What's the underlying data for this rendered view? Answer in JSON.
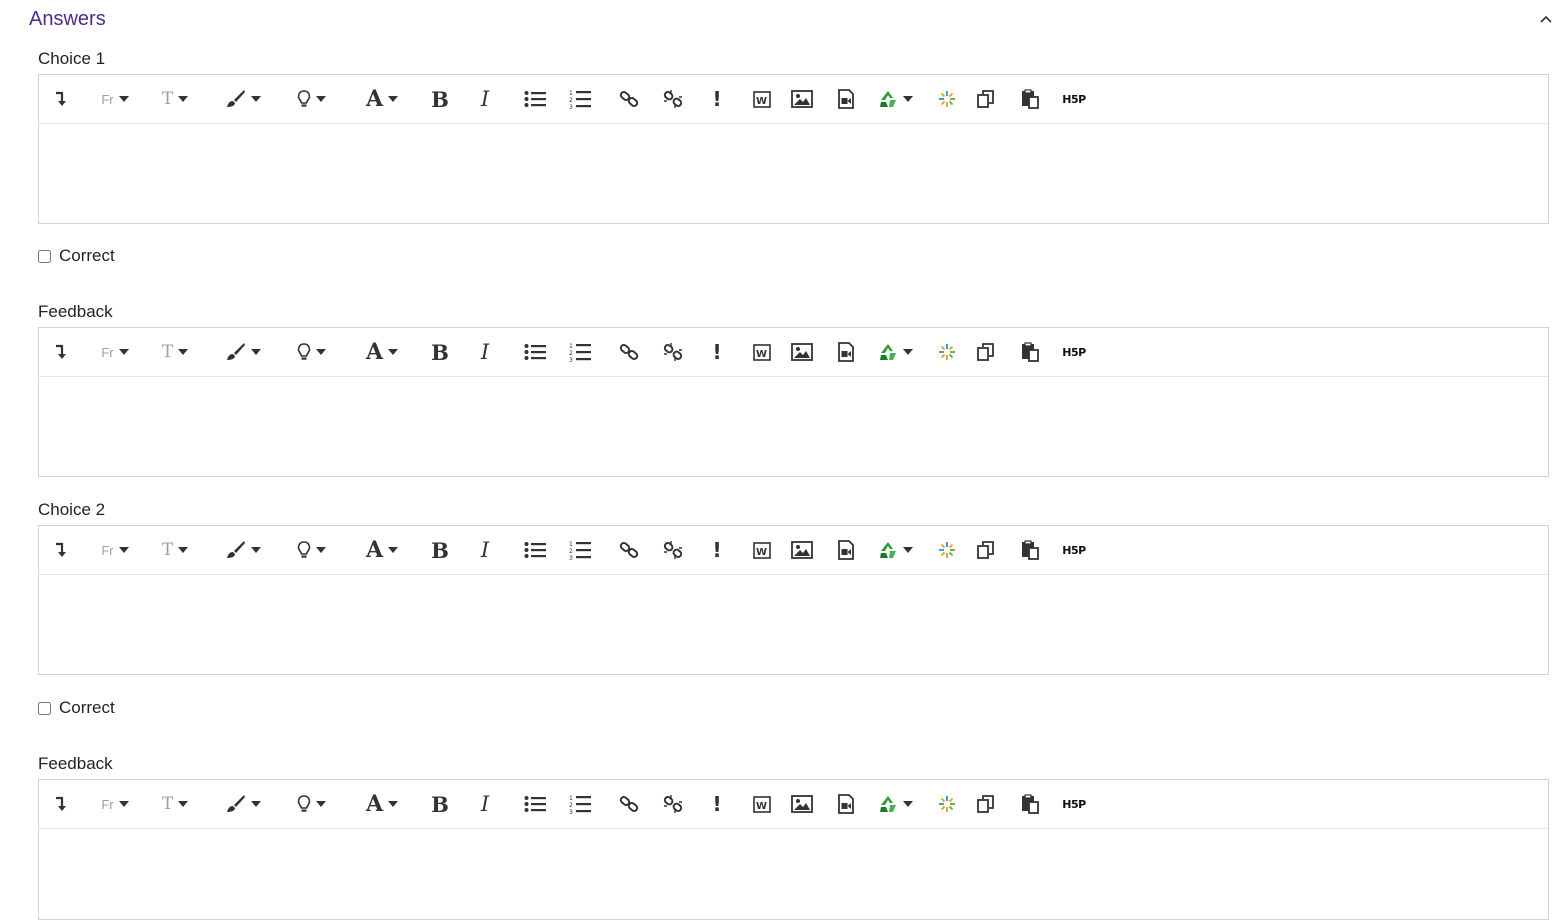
{
  "section": {
    "title": "Answers",
    "toggle_icon": "chevron-up-icon"
  },
  "toolbar_buttons": [
    "collapse-icon",
    "font-family-icon",
    "font-size-icon",
    "paintbrush-icon",
    "lightbulb-icon",
    "font-color-icon",
    "bold-icon",
    "italic-icon",
    "unordered-list-icon",
    "ordered-list-icon",
    "link-icon",
    "unlink-icon",
    "emoji-icon",
    "word-import-icon",
    "image-icon",
    "media-icon",
    "recycle-icon",
    "kaltura-icon",
    "copy-icon",
    "paste-icon",
    "h5p-icon"
  ],
  "toolbar_text": {
    "font_family": "Fr",
    "font_size": "T",
    "font_color": "A",
    "bold": "B",
    "italic": "I",
    "emoji": "!",
    "word": "W",
    "h5p": "H5P"
  },
  "fields": {
    "choice1": {
      "label": "Choice 1",
      "value": ""
    },
    "correct1": {
      "label": "Correct",
      "checked": false
    },
    "feedback1": {
      "label": "Feedback",
      "value": ""
    },
    "choice2": {
      "label": "Choice 2",
      "value": ""
    },
    "correct2": {
      "label": "Correct",
      "checked": false
    },
    "feedback2": {
      "label": "Feedback",
      "value": ""
    }
  },
  "colors": {
    "title": "#4b2c8c",
    "border": "#cfd3d7",
    "icon": "#333333",
    "recycle_green": "#2e9b3a"
  }
}
